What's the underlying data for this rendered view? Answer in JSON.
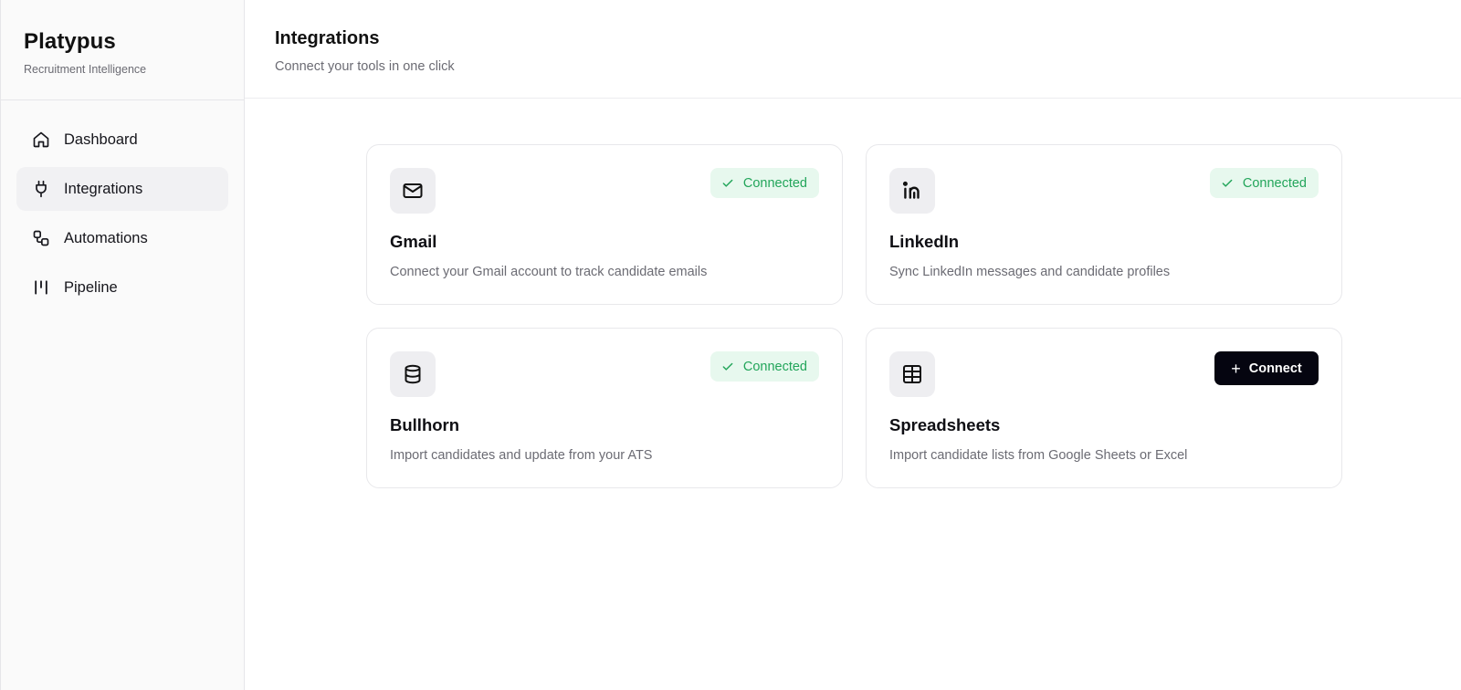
{
  "brand": {
    "title": "Platypus",
    "subtitle": "Recruitment Intelligence"
  },
  "sidebar": {
    "items": [
      {
        "label": "Dashboard",
        "icon": "home-icon",
        "active": false
      },
      {
        "label": "Integrations",
        "icon": "plug-icon",
        "active": true
      },
      {
        "label": "Automations",
        "icon": "workflow-icon",
        "active": false
      },
      {
        "label": "Pipeline",
        "icon": "pipeline-icon",
        "active": false
      }
    ]
  },
  "header": {
    "title": "Integrations",
    "subtitle": "Connect your tools in one click"
  },
  "integrations": [
    {
      "name": "Gmail",
      "description": "Connect your Gmail account to track candidate emails",
      "icon": "mail-icon",
      "status": "Connected"
    },
    {
      "name": "LinkedIn",
      "description": "Sync LinkedIn messages and candidate profiles",
      "icon": "linkedin-icon",
      "status": "Connected"
    },
    {
      "name": "Bullhorn",
      "description": "Import candidates and update from your ATS",
      "icon": "database-icon",
      "status": "Connected"
    },
    {
      "name": "Spreadsheets",
      "description": "Import candidate lists from Google Sheets or Excel",
      "icon": "table-icon",
      "action": "Connect"
    }
  ],
  "colors": {
    "connected_bg": "#e7f8ee",
    "connected_text": "#22a55a",
    "button_bg": "#050510",
    "active_nav_bg": "#f1f1f3"
  }
}
